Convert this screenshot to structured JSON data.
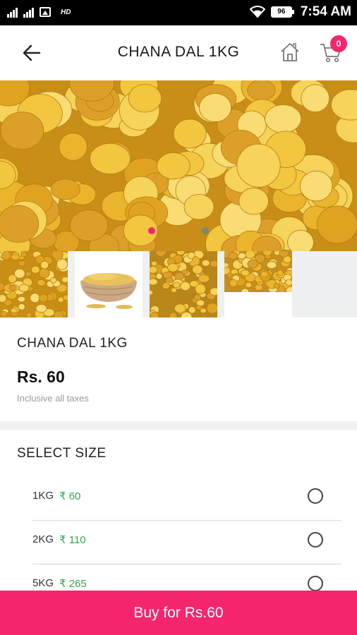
{
  "status_bar": {
    "signal_1": "",
    "signal_2": "",
    "hd_label": "HD",
    "battery": "96",
    "time": "7:54 AM"
  },
  "header": {
    "title": "CHANA DAL 1KG",
    "cart_count": "0"
  },
  "icons": {
    "back": "arrow-left-icon",
    "home": "home-icon",
    "cart": "cart-icon"
  },
  "carousel": {
    "active_index": 0,
    "slide_count": 2,
    "active_color": "#f5266f",
    "inactive_color": "#7a8a6a"
  },
  "product": {
    "name": "CHANA DAL 1KG",
    "price": "Rs. 60",
    "tax_note": "Inclusive all taxes"
  },
  "sizes": {
    "title": "SELECT SIZE",
    "options": [
      {
        "label": "1KG",
        "price": "₹ 60"
      },
      {
        "label": "2KG",
        "price": "₹ 110"
      },
      {
        "label": "5KG",
        "price": "₹ 265"
      }
    ]
  },
  "buy_button": "Buy for Rs.60",
  "colors": {
    "accent": "#f5266f",
    "price_green": "#2fa84f"
  }
}
